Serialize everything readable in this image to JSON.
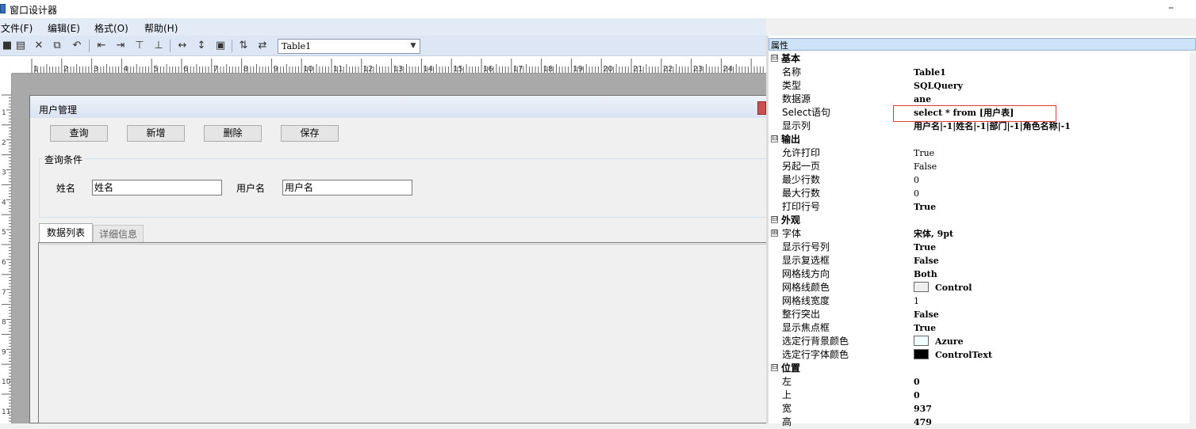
{
  "window": {
    "title": "窗口设计器",
    "minimize_glyph": "–"
  },
  "menu": [
    "文件(F)",
    "编辑(E)",
    "格式(O)",
    "帮助(H)"
  ],
  "toolbar": {
    "icons": [
      "save-icon",
      "layout-icon",
      "delete-icon",
      "copy-icon",
      "undo-icon",
      "align-left-icon",
      "align-right-icon",
      "align-top-icon",
      "align-bottom-icon",
      "same-width-icon",
      "same-height-icon",
      "same-size-icon",
      "vertical-spacing-icon",
      "horizontal-spacing-icon"
    ],
    "combo_value": "Table1"
  },
  "ruler": {
    "h_numbers": [
      "1",
      "2",
      "3",
      "4",
      "5",
      "6",
      "7",
      "8",
      "9",
      "10",
      "11",
      "12",
      "13",
      "14",
      "15",
      "16",
      "17",
      "18",
      "19",
      "20",
      "21",
      "22",
      "23",
      "24"
    ],
    "v_numbers": [
      "1",
      "2",
      "3",
      "4",
      "5",
      "6",
      "7",
      "8",
      "9",
      "10",
      "11"
    ]
  },
  "form": {
    "title": "用户管理",
    "buttons": {
      "query": "查询",
      "add": "新增",
      "delete": "删除",
      "save": "保存"
    },
    "group_title": "查询条件",
    "fields": {
      "name_label": "姓名",
      "name_value": "姓名",
      "username_label": "用户名",
      "username_value": "用户名"
    },
    "tabs": {
      "list": "数据列表",
      "detail": "详细信息"
    }
  },
  "properties": {
    "header": "属性",
    "rows": [
      {
        "type": "cat",
        "name": "基本",
        "toggle": "⊟"
      },
      {
        "name": "名称",
        "value": "Table1",
        "bold": true
      },
      {
        "name": "类型",
        "value": "SQLQuery",
        "bold": true
      },
      {
        "name": "数据源",
        "value": "ane",
        "bold": true
      },
      {
        "name": "Select语句",
        "value": "select * from [用户表]",
        "bold": true
      },
      {
        "name": "显示列",
        "value": "用户名|-1|姓名|-1|部门|-1|角色名称|-1",
        "bold": true
      },
      {
        "type": "cat",
        "name": "输出",
        "toggle": "⊟"
      },
      {
        "name": "允许打印",
        "value": "True"
      },
      {
        "name": "另起一页",
        "value": "False"
      },
      {
        "name": "最少行数",
        "value": "0"
      },
      {
        "name": "最大行数",
        "value": "0"
      },
      {
        "name": "打印行号",
        "value": "True",
        "bold": true
      },
      {
        "type": "cat",
        "name": "外观",
        "toggle": "⊟"
      },
      {
        "name": "字体",
        "value": "宋体, 9pt",
        "bold": true,
        "toggle": "⊞"
      },
      {
        "name": "显示行号列",
        "value": "True",
        "bold": true
      },
      {
        "name": "显示复选框",
        "value": "False",
        "bold": true
      },
      {
        "name": "网格线方向",
        "value": "Both",
        "bold": true
      },
      {
        "name": "网格线颜色",
        "value": "Control",
        "bold": true,
        "swatch": "#f0f0f0"
      },
      {
        "name": "网格线宽度",
        "value": "1"
      },
      {
        "name": "整行突出",
        "value": "False",
        "bold": true
      },
      {
        "name": "显示焦点框",
        "value": "True",
        "bold": true
      },
      {
        "name": "选定行背景颜色",
        "value": "Azure",
        "bold": true,
        "swatch": "#f0ffff"
      },
      {
        "name": "选定行字体颜色",
        "value": "ControlText",
        "bold": true,
        "swatch": "#000000"
      },
      {
        "type": "cat",
        "name": "位置",
        "toggle": "⊟"
      },
      {
        "name": "左",
        "value": "0",
        "bold": true
      },
      {
        "name": "上",
        "value": "0",
        "bold": true
      },
      {
        "name": "宽",
        "value": "937",
        "bold": true
      },
      {
        "name": "高",
        "value": "479",
        "bold": true
      }
    ]
  },
  "colors": {
    "highlight_border": "#e03a3a",
    "menu_bg": "#e3ebf7",
    "toolbar_bg": "#dde6f4"
  }
}
